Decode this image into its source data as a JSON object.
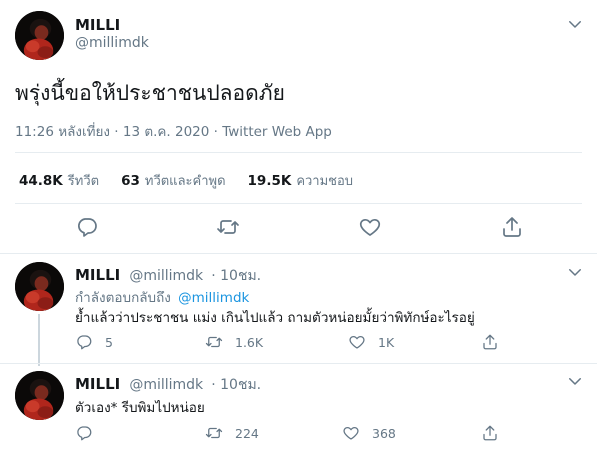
{
  "main_tweet": {
    "display_name": "MILLI",
    "handle": "@millimdk",
    "text": "พรุ่งนี้ขอให้ประชาชนปลอดภัย",
    "meta": "11:26 หลังเที่ยง · 13 ต.ค. 2020 · Twitter Web App",
    "stats": [
      {
        "num": "44.8K",
        "label": "รีทวีต"
      },
      {
        "num": "63",
        "label": "ทวีตและคำพูด"
      },
      {
        "num": "19.5K",
        "label": "ความชอบ"
      }
    ]
  },
  "replies": [
    {
      "display_name": "MILLI",
      "handle": "@millimdk",
      "time": "· 10ชม.",
      "replying_prefix": "กำลังตอบกลับถึง",
      "replying_to": "@millimdk",
      "text": "ย้ำแล้วว่าประชาชน แม่ง เกินไปแล้ว ถามตัวหน่อยมั้ยว่าพิทักษ์อะไรอยู่",
      "reply_count": "5",
      "retweet_count": "1.6K",
      "like_count": "1K"
    },
    {
      "display_name": "MILLI",
      "handle": "@millimdk",
      "time": "· 10ชม.",
      "text": "ตัวเอง* รีบพิมไปหน่อย",
      "reply_count": "",
      "retweet_count": "224",
      "like_count": "368"
    }
  ],
  "icons": [
    "chevron-down-icon",
    "reply-icon",
    "retweet-icon",
    "like-icon",
    "share-icon"
  ],
  "colors": {
    "link": "#1b95e0",
    "muted": "#657786",
    "text": "#14171a",
    "divider": "#e6ecf0"
  }
}
